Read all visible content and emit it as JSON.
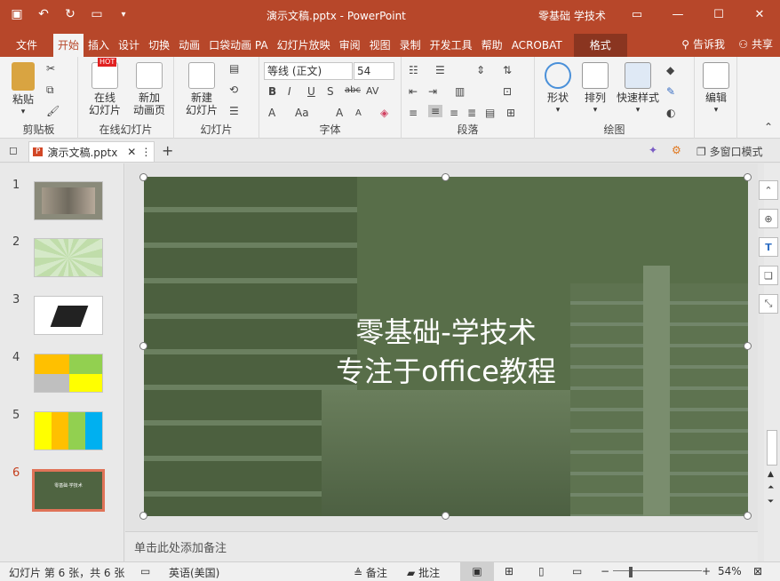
{
  "titlebar": {
    "doc_title": "演示文稿.pptx  -  PowerPoint",
    "account": "零基础 学技术"
  },
  "tabs": [
    {
      "label": "文件"
    },
    {
      "label": "开始"
    },
    {
      "label": "插入"
    },
    {
      "label": "设计"
    },
    {
      "label": "切换"
    },
    {
      "label": "动画"
    },
    {
      "label": "口袋动画 PA"
    },
    {
      "label": "幻灯片放映"
    },
    {
      "label": "审阅"
    },
    {
      "label": "视图"
    },
    {
      "label": "录制"
    },
    {
      "label": "开发工具"
    },
    {
      "label": "帮助"
    },
    {
      "label": "ACROBAT"
    },
    {
      "label": "格式"
    }
  ],
  "tellme": "告诉我",
  "share": "共享",
  "ribbon": {
    "clipboard": {
      "paste": "粘贴",
      "label": "剪贴板"
    },
    "online": {
      "btn1": "在线",
      "btn1b": "幻灯片",
      "btn2": "新加",
      "btn2b": "动画页",
      "hot": "HOT",
      "label": "在线幻灯片"
    },
    "slides": {
      "new": "新建",
      "newb": "幻灯片",
      "label": "幻灯片"
    },
    "font": {
      "name": "等线 (正文)",
      "size": "54",
      "label": "字体"
    },
    "paragraph": {
      "label": "段落"
    },
    "drawing": {
      "shapes": "形状",
      "arrange": "排列",
      "quick": "快速样式",
      "label": "绘图"
    },
    "editing": {
      "label": "编辑"
    }
  },
  "filetab": {
    "name": "演示文稿.pptx",
    "multiwindow": "多窗口模式"
  },
  "slides": [
    {
      "num": "1"
    },
    {
      "num": "2"
    },
    {
      "num": "3"
    },
    {
      "num": "4"
    },
    {
      "num": "5"
    },
    {
      "num": "6"
    }
  ],
  "slide": {
    "line1": "零基础-学技术",
    "line2": "专注于office教程",
    "thumb_text": "零基础·学技术"
  },
  "notes": "单击此处添加备注",
  "status": {
    "slide_info": "幻灯片 第 6 张，共 6 张",
    "language": "英语(美国)",
    "notes": "备注",
    "comments": "批注",
    "zoom": "54%"
  },
  "colors": {
    "accent": "#b7472a",
    "slide_overlay": "#586e49"
  }
}
